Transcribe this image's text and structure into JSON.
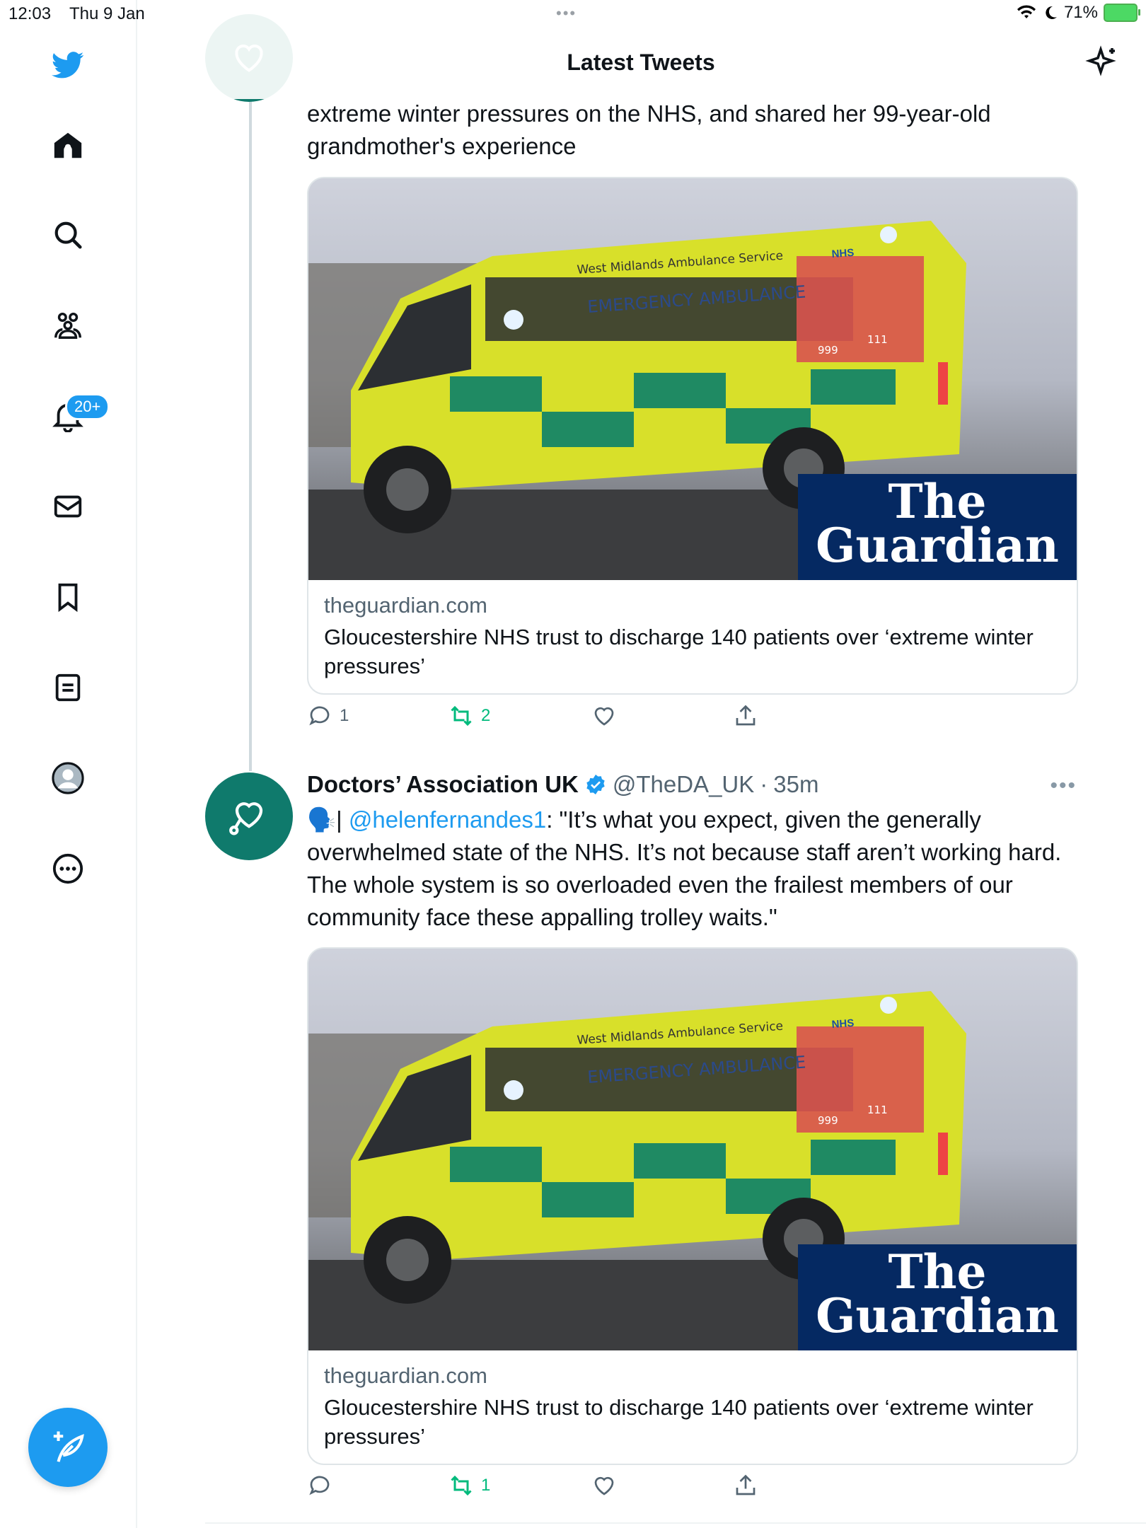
{
  "status_bar": {
    "time": "12:03",
    "date": "Thu 9 Jan",
    "battery": "71%"
  },
  "sidebar": {
    "notifications_badge": "20+"
  },
  "header": {
    "title": "Latest Tweets"
  },
  "tweet1": {
    "text": "extreme winter pressures on the NHS, and shared her 99-year-old grandmother's experience",
    "card": {
      "image_text": {
        "service": "West Midlands Ambulance Service",
        "vehicle": "EMERGENCY AMBULANCE",
        "nhs": "NHS",
        "call_number": "111",
        "emergency_number": "999",
        "brand_line1": "The",
        "brand_line2": "Guardian"
      },
      "domain": "theguardian.com",
      "title": "Gloucestershire NHS trust to discharge 140 patients over ‘extreme winter pressures’"
    },
    "actions": {
      "replies": "1",
      "retweets": "2"
    }
  },
  "tweet2": {
    "author_name": "Doctors’ Association UK",
    "handle": "@TheDA_UK",
    "time": "35m",
    "text_prefix": "🗣️| ",
    "mention": "@helenfernandes1",
    "text_body": ":  \"It’s what you expect, given the generally overwhelmed state of the NHS. It’s not because staff aren’t working hard. The whole system is so overloaded even the frailest members of our community face these appalling trolley waits.\"",
    "card": {
      "image_text": {
        "service": "West Midlands Ambulance Service",
        "vehicle": "EMERGENCY AMBULANCE",
        "nhs": "NHS",
        "call_number": "111",
        "emergency_number": "999",
        "brand_line1": "The",
        "brand_line2": "Guardian"
      },
      "domain": "theguardian.com",
      "title": "Gloucestershire NHS trust to discharge 140 patients over ‘extreme winter pressures’"
    },
    "actions": {
      "replies": "",
      "retweets": "1"
    }
  },
  "colors": {
    "accent": "#1d9bf0",
    "retweet": "#00ba7c",
    "avatar": "#0f7a6c",
    "guardian_blue": "#052962"
  },
  "icons": [
    "twitter-logo-icon",
    "home-icon",
    "search-icon",
    "communities-icon",
    "bell-icon",
    "mail-icon",
    "bookmark-icon",
    "lists-icon",
    "profile-icon",
    "more-icon",
    "compose-icon",
    "sparkle-icon",
    "reply-icon",
    "retweet-icon",
    "like-icon",
    "share-icon",
    "verified-icon"
  ]
}
